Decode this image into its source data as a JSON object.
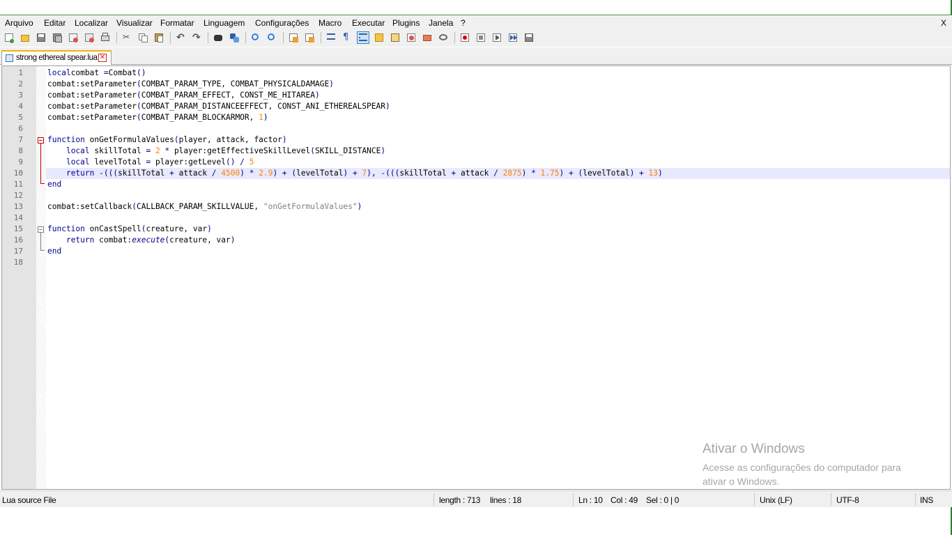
{
  "menu": [
    "Arquivo",
    "Editar",
    "Localizar",
    "Visualizar",
    "Formatar",
    "Linguagem",
    "Configurações",
    "Macro",
    "Executar",
    "Plugins",
    "Janela",
    "?"
  ],
  "close_label": "X",
  "toolbar_icons": [
    "new-file-icon",
    "open-file-icon",
    "save-icon",
    "save-all-icon",
    "close-icon",
    "close-all-icon",
    "print-icon",
    "cut-icon",
    "copy-icon",
    "paste-icon",
    "undo-icon",
    "redo-icon",
    "find-icon",
    "replace-icon",
    "zoom-in-icon",
    "zoom-out-icon",
    "sync-vertical-icon",
    "sync-horizontal-icon",
    "word-wrap-icon",
    "show-all-chars-icon",
    "indent-guide-icon",
    "doc-map-icon",
    "function-list-icon",
    "folder-workspace-icon",
    "monitor-icon",
    "record-macro-icon",
    "stop-record-icon",
    "play-macro-icon",
    "run-macro-multiple-icon",
    "save-macro-icon"
  ],
  "tab": {
    "label": "strong ethereal spear.lua",
    "close_label": "✕"
  },
  "editor": {
    "line_numbers": [
      "1",
      "2",
      "3",
      "4",
      "5",
      "6",
      "7",
      "8",
      "9",
      "10",
      "11",
      "12",
      "13",
      "14",
      "15",
      "16",
      "17",
      "18"
    ],
    "current_line": 10,
    "lines": [
      [
        [
          "kw",
          "local"
        ],
        [
          "",
          "combat "
        ],
        [
          "op",
          "="
        ],
        [
          "",
          "Combat"
        ],
        [
          "op",
          "()"
        ]
      ],
      [
        [
          "",
          "combat:setParameter"
        ],
        [
          "op",
          "("
        ],
        [
          "",
          "COMBAT_PARAM_TYPE"
        ],
        [
          "op",
          ","
        ],
        [
          "",
          " COMBAT_PHYSICALDAMAGE"
        ],
        [
          "op",
          ")"
        ]
      ],
      [
        [
          "",
          "combat:setParameter"
        ],
        [
          "op",
          "("
        ],
        [
          "",
          "COMBAT_PARAM_EFFECT"
        ],
        [
          "op",
          ","
        ],
        [
          "",
          " CONST_ME_HITAREA"
        ],
        [
          "op",
          ")"
        ]
      ],
      [
        [
          "",
          "combat:setParameter"
        ],
        [
          "op",
          "("
        ],
        [
          "",
          "COMBAT_PARAM_DISTANCEEFFECT"
        ],
        [
          "op",
          ","
        ],
        [
          "",
          " CONST_ANI_ETHEREALSPEAR"
        ],
        [
          "op",
          ")"
        ]
      ],
      [
        [
          "",
          "combat:setParameter"
        ],
        [
          "op",
          "("
        ],
        [
          "",
          "COMBAT_PARAM_BLOCKARMOR"
        ],
        [
          "op",
          ","
        ],
        [
          "op",
          " "
        ],
        [
          "num",
          "1"
        ],
        [
          "op",
          ")"
        ]
      ],
      [],
      [
        [
          "kw",
          "function"
        ],
        [
          "",
          " onGetFormulaValues"
        ],
        [
          "op",
          "("
        ],
        [
          "",
          "player"
        ],
        [
          "op",
          ","
        ],
        [
          "",
          " attack"
        ],
        [
          "op",
          ","
        ],
        [
          "",
          " factor"
        ],
        [
          "op",
          ")"
        ]
      ],
      [
        [
          "",
          "    "
        ],
        [
          "kw",
          "local"
        ],
        [
          "",
          " skillTotal "
        ],
        [
          "op",
          "="
        ],
        [
          "op",
          " "
        ],
        [
          "num",
          "2"
        ],
        [
          "op",
          " *"
        ],
        [
          "",
          " player:getEffectiveSkillLevel"
        ],
        [
          "op",
          "("
        ],
        [
          "",
          "SKILL_DISTANCE"
        ],
        [
          "op",
          ")"
        ]
      ],
      [
        [
          "",
          "    "
        ],
        [
          "kw",
          "local"
        ],
        [
          "",
          " levelTotal "
        ],
        [
          "op",
          "="
        ],
        [
          "",
          " player:getLevel"
        ],
        [
          "op",
          "()"
        ],
        [
          "op",
          " / "
        ],
        [
          "num",
          "5"
        ]
      ],
      [
        [
          "",
          "    "
        ],
        [
          "kw",
          "return"
        ],
        [
          "op",
          " -((("
        ],
        [
          "",
          "skillTotal "
        ],
        [
          "op",
          "+"
        ],
        [
          "",
          " attack "
        ],
        [
          "op",
          "/"
        ],
        [
          "op",
          " "
        ],
        [
          "num",
          "4500"
        ],
        [
          "op",
          ")"
        ],
        [
          "op",
          " * "
        ],
        [
          "num",
          "2.9"
        ],
        [
          "op",
          ")"
        ],
        [
          "op",
          " + ("
        ],
        [
          "",
          "levelTotal"
        ],
        [
          "op",
          ")"
        ],
        [
          "op",
          " + "
        ],
        [
          "num",
          "7"
        ],
        [
          "op",
          "),"
        ],
        [
          "op",
          " -((("
        ],
        [
          "",
          "skillTotal "
        ],
        [
          "op",
          "+"
        ],
        [
          "",
          " attack "
        ],
        [
          "op",
          "/"
        ],
        [
          "op",
          " "
        ],
        [
          "num",
          "2875"
        ],
        [
          "op",
          ")"
        ],
        [
          "op",
          " * "
        ],
        [
          "num",
          "1.75"
        ],
        [
          "op",
          ")"
        ],
        [
          "op",
          " + ("
        ],
        [
          "",
          "levelTotal"
        ],
        [
          "op",
          ")"
        ],
        [
          "op",
          " + "
        ],
        [
          "num",
          "13"
        ],
        [
          "op",
          ")"
        ]
      ],
      [
        [
          "kw",
          "end"
        ]
      ],
      [],
      [
        [
          "",
          "combat:setCallback"
        ],
        [
          "op",
          "("
        ],
        [
          "",
          "CALLBACK_PARAM_SKILLVALUE"
        ],
        [
          "op",
          ","
        ],
        [
          "str",
          " \"onGetFormulaValues\""
        ],
        [
          "op",
          ")"
        ]
      ],
      [],
      [
        [
          "kw",
          "function"
        ],
        [
          "",
          " onCastSpell"
        ],
        [
          "op",
          "("
        ],
        [
          "",
          "creature"
        ],
        [
          "op",
          ","
        ],
        [
          "",
          " var"
        ],
        [
          "op",
          ")"
        ]
      ],
      [
        [
          "",
          "    "
        ],
        [
          "kw",
          "return"
        ],
        [
          "",
          " combat:"
        ],
        [
          "fn-it",
          "execute"
        ],
        [
          "op",
          "("
        ],
        [
          "",
          "creature"
        ],
        [
          "op",
          ","
        ],
        [
          "",
          " var"
        ],
        [
          "op",
          ")"
        ]
      ],
      [
        [
          "kw",
          "end"
        ]
      ],
      []
    ]
  },
  "watermark": {
    "title": "Ativar o Windows",
    "subtitle": "Acesse as configurações do computador para ativar o Windows."
  },
  "status": {
    "file_type": "Lua source File",
    "length": "length : 713",
    "lines": "lines : 18",
    "ln": "Ln : 10",
    "col": "Col : 49",
    "sel": "Sel : 0 | 0",
    "eol": "Unix (LF)",
    "encoding": "UTF-8",
    "mode": "INS"
  }
}
